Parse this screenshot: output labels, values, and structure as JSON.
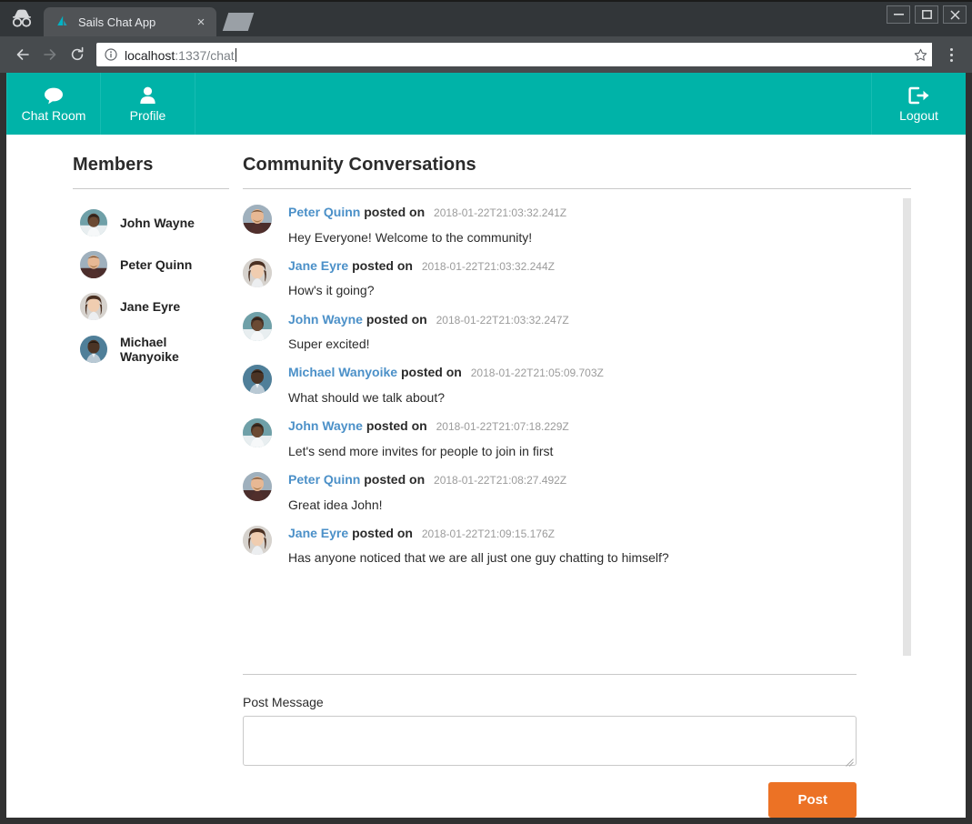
{
  "browser": {
    "incognito_icon": "incognito-hat-icon",
    "tab": {
      "title": "Sails Chat App",
      "favicon": "sails-logo-icon",
      "close_icon": "close-icon"
    },
    "new_tab_icon": "new-tab-icon",
    "window_controls": {
      "minimize": "–",
      "maximize": "☐",
      "close": "×"
    },
    "nav": {
      "back_icon": "back-arrow-icon",
      "forward_icon": "forward-arrow-icon",
      "reload_icon": "reload-icon"
    },
    "omnibox": {
      "info_icon": "info-circle-icon",
      "host": "localhost",
      "path": ":1337/chat",
      "full_url": "localhost:1337/chat",
      "bookmark_icon": "star-icon",
      "menu_icon": "three-dot-menu-icon"
    }
  },
  "appnav": {
    "brand_color": "#00b3a8",
    "items": [
      {
        "label": "Chat Room",
        "icon": "chat-bubble-icon"
      },
      {
        "label": "Profile",
        "icon": "user-icon"
      }
    ],
    "logout": {
      "label": "Logout",
      "icon": "sign-out-icon"
    }
  },
  "members": {
    "title": "Members",
    "list": [
      {
        "name": "John Wayne",
        "avatar": "avatar-john-wayne"
      },
      {
        "name": "Peter Quinn",
        "avatar": "avatar-peter-quinn"
      },
      {
        "name": "Jane Eyre",
        "avatar": "avatar-jane-eyre"
      },
      {
        "name": "Michael Wanyoike",
        "avatar": "avatar-michael-wanyoike"
      }
    ]
  },
  "chat": {
    "title": "Community Conversations",
    "posted_on_label": "posted on",
    "user_link_color": "#4b90c8",
    "messages": [
      {
        "user": "Peter Quinn",
        "avatar": "avatar-peter-quinn",
        "time": "2018-01-22T21:03:32.241Z",
        "text": "Hey Everyone! Welcome to the community!"
      },
      {
        "user": "Jane Eyre",
        "avatar": "avatar-jane-eyre",
        "time": "2018-01-22T21:03:32.244Z",
        "text": "How's it going?"
      },
      {
        "user": "John Wayne",
        "avatar": "avatar-john-wayne",
        "time": "2018-01-22T21:03:32.247Z",
        "text": "Super excited!"
      },
      {
        "user": "Michael Wanyoike",
        "avatar": "avatar-michael-wanyoike",
        "time": "2018-01-22T21:05:09.703Z",
        "text": "What should we talk about?"
      },
      {
        "user": "John Wayne",
        "avatar": "avatar-john-wayne",
        "time": "2018-01-22T21:07:18.229Z",
        "text": "Let's send more invites for people to join in first"
      },
      {
        "user": "Peter Quinn",
        "avatar": "avatar-peter-quinn",
        "time": "2018-01-22T21:08:27.492Z",
        "text": "Great idea John!"
      },
      {
        "user": "Jane Eyre",
        "avatar": "avatar-jane-eyre",
        "time": "2018-01-22T21:09:15.176Z",
        "text": "Has anyone noticed that we are all just one guy chatting to himself?"
      }
    ]
  },
  "postform": {
    "label": "Post Message",
    "textarea_value": "",
    "textarea_placeholder": "",
    "button_label": "Post",
    "button_color": "#ec7225"
  }
}
